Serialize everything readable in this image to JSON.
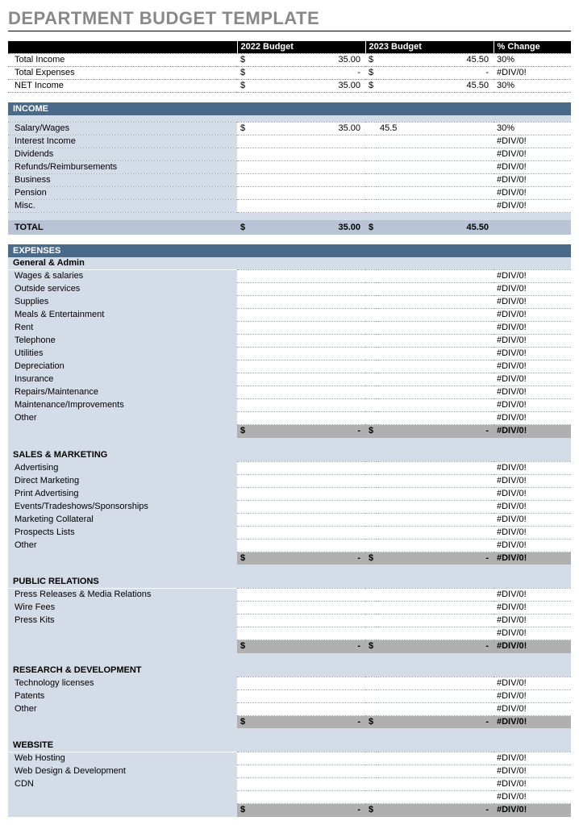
{
  "title": "DEPARTMENT BUDGET TEMPLATE",
  "headers": {
    "col_b1": "2022 Budget",
    "col_b2": "2023 Budget",
    "col_pc": "% Change"
  },
  "summary": [
    {
      "label": "Total Income",
      "c1": "$",
      "v1": "35.00",
      "c2": "$",
      "v2": "45.50",
      "pc": "30%"
    },
    {
      "label": "Total Expenses",
      "c1": "$",
      "v1": "-",
      "c2": "$",
      "v2": "-",
      "pc": "#DIV/0!"
    },
    {
      "label": "NET Income",
      "c1": "$",
      "v1": "35.00",
      "c2": "$",
      "v2": "45.50",
      "pc": "30%"
    }
  ],
  "income": {
    "title": "INCOME",
    "rows": [
      {
        "label": "Salary/Wages",
        "c1": "$",
        "v1": "35.00",
        "v2": "45.5",
        "pc": "30%"
      },
      {
        "label": "Interest Income",
        "c1": "",
        "v1": "",
        "v2": "",
        "pc": "#DIV/0!"
      },
      {
        "label": "Dividends",
        "c1": "",
        "v1": "",
        "v2": "",
        "pc": "#DIV/0!"
      },
      {
        "label": "Refunds/Reimbursements",
        "c1": "",
        "v1": "",
        "v2": "",
        "pc": "#DIV/0!"
      },
      {
        "label": "Business",
        "c1": "",
        "v1": "",
        "v2": "",
        "pc": "#DIV/0!"
      },
      {
        "label": "Pension",
        "c1": "",
        "v1": "",
        "v2": "",
        "pc": "#DIV/0!"
      },
      {
        "label": "Misc.",
        "c1": "",
        "v1": "",
        "v2": "",
        "pc": "#DIV/0!"
      }
    ],
    "total": {
      "label": "TOTAL",
      "c1": "$",
      "v1": "35.00",
      "c2": "$",
      "v2": "45.50",
      "pc": ""
    }
  },
  "expenses": {
    "title": "EXPENSES",
    "categories": [
      {
        "name": "General & Admin",
        "rows": [
          "Wages & salaries",
          "Outside services",
          "Supplies",
          "Meals & Entertainment",
          "Rent",
          "Telephone",
          "Utilities",
          "Depreciation",
          "Insurance",
          "Repairs/Maintenance",
          "Maintenance/Improvements",
          "Other"
        ]
      },
      {
        "name": "SALES & MARKETING",
        "rows": [
          "Advertising",
          "Direct Marketing",
          "Print Advertising",
          "Events/Tradeshows/Sponsorships",
          "Marketing Collateral",
          "Prospects Lists",
          "Other"
        ]
      },
      {
        "name": "PUBLIC RELATIONS",
        "rows": [
          "Press Releases & Media Relations",
          "Wire Fees",
          "Press Kits",
          ""
        ]
      },
      {
        "name": "RESEARCH & DEVELOPMENT",
        "rows": [
          "Technology licenses",
          "Patents",
          "Other"
        ]
      },
      {
        "name": "WEBSITE",
        "rows": [
          "Web Hosting",
          "Web Design & Development",
          "CDN",
          ""
        ]
      }
    ],
    "cat_total": {
      "c1": "$",
      "v1": "-",
      "c2": "$",
      "v2": "-",
      "pc": "#DIV/0!"
    },
    "div0": "#DIV/0!"
  }
}
